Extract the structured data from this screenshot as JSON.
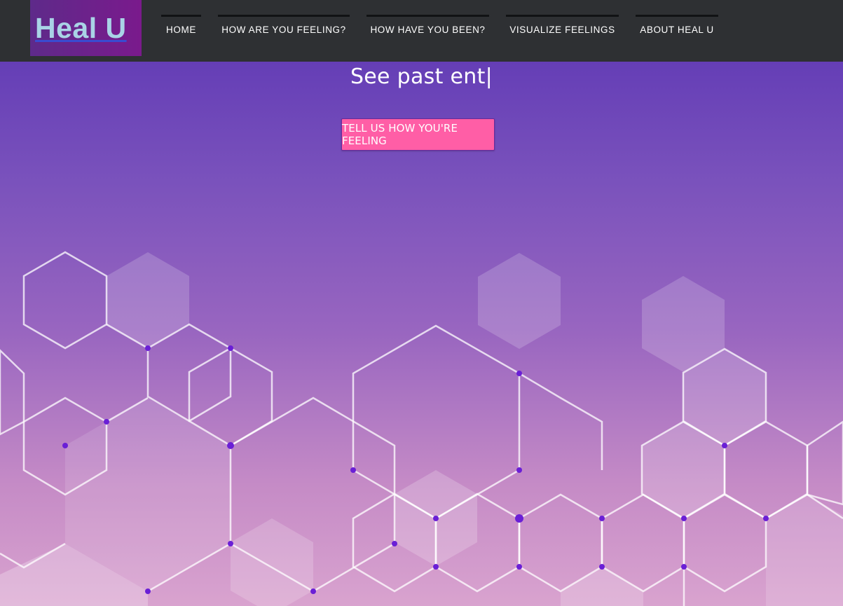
{
  "brand": {
    "logo_text": "Heal U"
  },
  "nav": {
    "items": [
      {
        "label": "HOME"
      },
      {
        "label": "HOW ARE YOU FEELING?"
      },
      {
        "label": "HOW HAVE YOU BEEN?"
      },
      {
        "label": "VISUALIZE FEELINGS"
      },
      {
        "label": "ABOUT HEAL U"
      }
    ]
  },
  "hero": {
    "typing_text": "See past ent|",
    "cta_label": "TELL US HOW YOU'RE FEELING"
  },
  "colors": {
    "navbar_bg": "#2e3033",
    "cta_bg": "#ff5ea6",
    "logo_text": "#a9d3e6",
    "gradient_top": "#5a34b3",
    "gradient_bottom": "#d9a3cf"
  }
}
